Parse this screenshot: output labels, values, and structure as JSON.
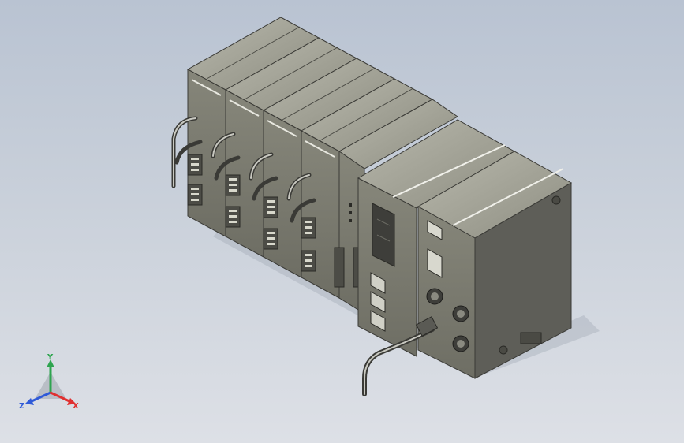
{
  "viewport": {
    "background_top": "#b9c3d2",
    "background_bottom": "#dde0e6",
    "body_color": "#7e7e72",
    "top_face_color": "#a4a498",
    "side_face_color": "#5e5e58"
  },
  "model": {
    "module_count": 7,
    "icons": [
      "plc-rack-assembly",
      "terminal-block",
      "cable",
      "connector-port",
      "led-indicator"
    ]
  },
  "triad": {
    "y_label": "Y",
    "x_label": "X",
    "z_label": "Z",
    "y_color": "#2ea44f",
    "x_color": "#e03030",
    "z_color": "#2f5ad8"
  }
}
